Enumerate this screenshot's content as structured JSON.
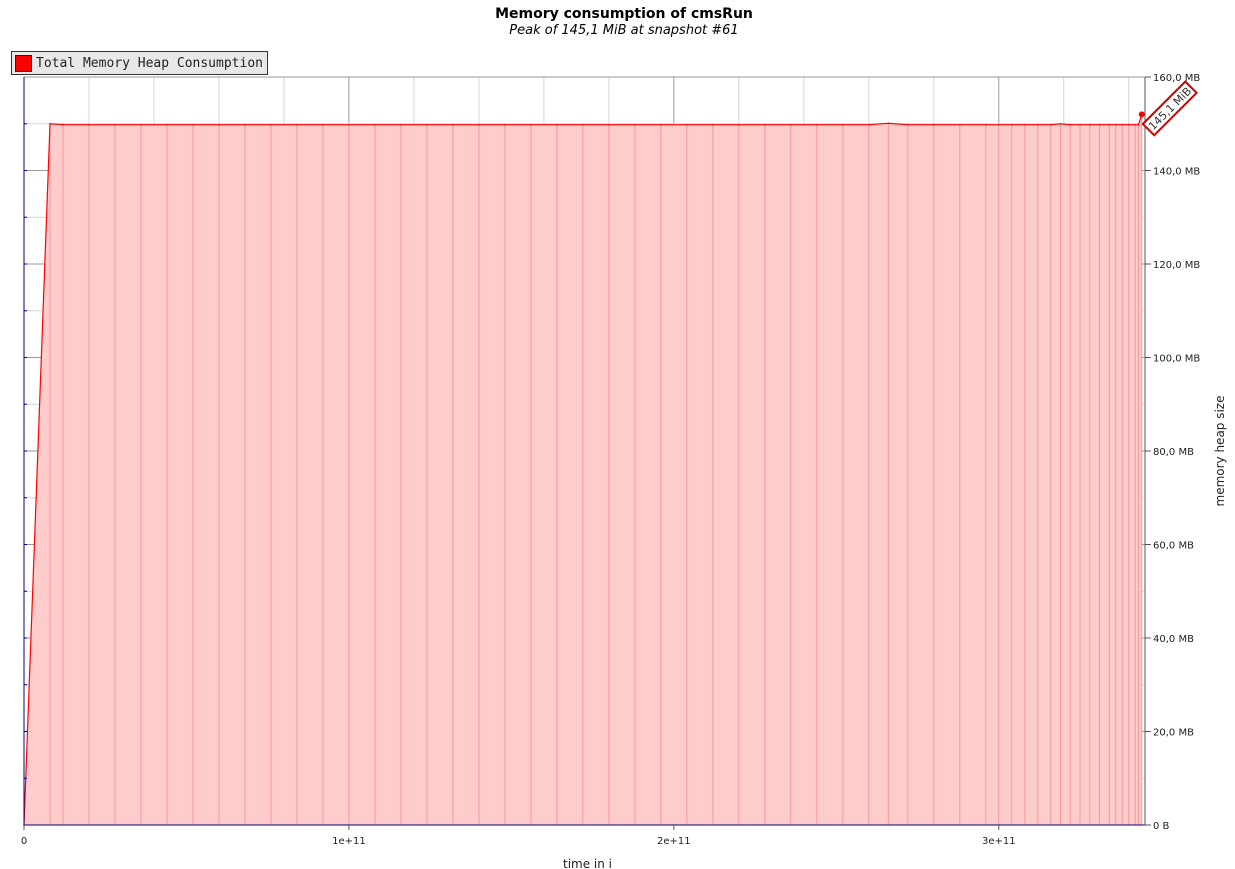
{
  "title": "Memory consumption of cmsRun",
  "subtitle": "Peak of 145,1 MiB at snapshot #61",
  "legend": {
    "label": "Total Memory Heap Consumption",
    "color": "#ff0000"
  },
  "colors": {
    "line": "#ff0000",
    "fill": "#ffcccc",
    "axis": "#000080"
  },
  "chart_data": {
    "type": "area",
    "xlabel": "time in i",
    "ylabel": "memory heap size",
    "xlim": [
      0,
      345000000000
    ],
    "ylim": [
      0,
      160
    ],
    "x_ticks": [
      {
        "value": 0,
        "label": "0"
      },
      {
        "value": 100000000000,
        "label": "1e+11"
      },
      {
        "value": 200000000000,
        "label": "2e+11"
      },
      {
        "value": 300000000000,
        "label": "3e+11"
      }
    ],
    "y_ticks": [
      {
        "value": 0,
        "label": "0 B"
      },
      {
        "value": 20,
        "label": "20,0 MB"
      },
      {
        "value": 40,
        "label": "40,0 MB"
      },
      {
        "value": 60,
        "label": "60,0 MB"
      },
      {
        "value": 80,
        "label": "80,0 MB"
      },
      {
        "value": 100,
        "label": "100,0 MB"
      },
      {
        "value": 120,
        "label": "120,0 MB"
      },
      {
        "value": 140,
        "label": "140,0 MB"
      },
      {
        "value": 160,
        "label": "160,0 MB"
      }
    ],
    "series": [
      {
        "name": "Total Memory Heap Consumption",
        "x": [
          0,
          8000000000,
          12000000000,
          20000000000,
          28000000000,
          36000000000,
          44000000000,
          52000000000,
          60000000000,
          68000000000,
          76000000000,
          84000000000,
          92000000000,
          100000000000,
          108000000000,
          116000000000,
          124000000000,
          132000000000,
          140000000000,
          148000000000,
          156000000000,
          164000000000,
          172000000000,
          180000000000,
          188000000000,
          196000000000,
          204000000000,
          212000000000,
          220000000000,
          228000000000,
          236000000000,
          244000000000,
          252000000000,
          260000000000,
          266000000000,
          272000000000,
          280000000000,
          288000000000,
          296000000000,
          300000000000,
          304000000000,
          308000000000,
          312000000000,
          316000000000,
          319000000000,
          322000000000,
          325000000000,
          328000000000,
          331000000000,
          334000000000,
          336000000000,
          338000000000,
          340000000000,
          342000000000,
          343000000000,
          344000000000
        ],
        "values": [
          0,
          150.0,
          149.8,
          149.8,
          149.8,
          149.8,
          149.8,
          149.8,
          149.8,
          149.8,
          149.8,
          149.8,
          149.8,
          149.8,
          149.8,
          149.8,
          149.8,
          149.8,
          149.8,
          149.8,
          149.8,
          149.8,
          149.8,
          149.8,
          149.8,
          149.8,
          149.8,
          149.8,
          149.8,
          149.8,
          149.8,
          149.8,
          149.8,
          149.8,
          150.1,
          149.8,
          149.8,
          149.8,
          149.8,
          149.8,
          149.8,
          149.8,
          149.8,
          149.8,
          150.0,
          149.8,
          149.8,
          149.8,
          149.8,
          149.8,
          149.8,
          149.8,
          149.8,
          149.8,
          149.8,
          152.0
        ]
      }
    ],
    "annotations": [
      {
        "text": "145,1 MiB",
        "x": 344000000000,
        "y": 152.0
      }
    ],
    "grid": true,
    "legend_position": "top-left"
  }
}
